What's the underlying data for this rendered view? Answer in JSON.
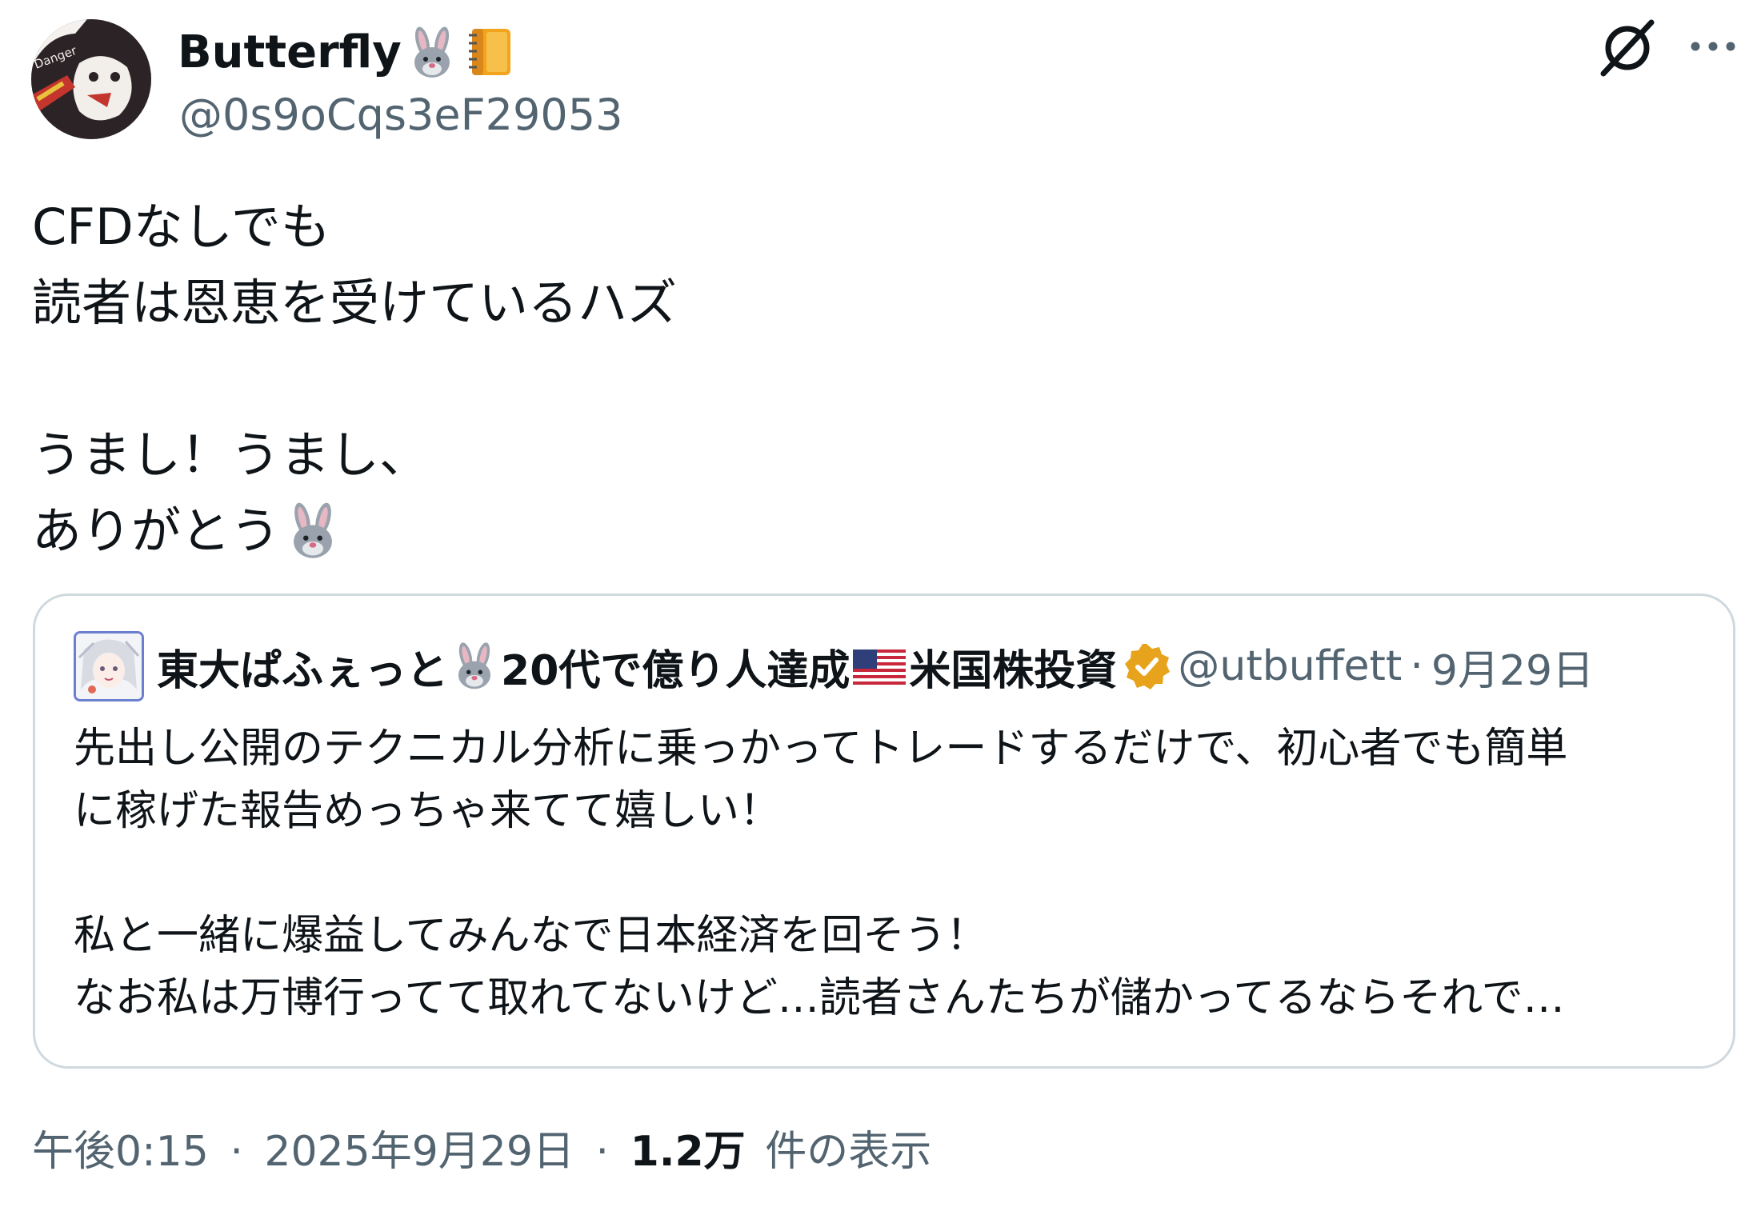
{
  "author": {
    "display_name": "Butterfly",
    "name_emojis": [
      "rabbit-emoji",
      "notebook-emoji"
    ],
    "handle": "@0s9oCqs3eF29053",
    "avatar_label": "Danger"
  },
  "tweet": {
    "lines": [
      "CFDなしでも",
      "読者は恩恵を受けているハズ",
      "",
      "うまし！うまし、",
      "ありがとう"
    ]
  },
  "quote": {
    "display_name_part1": "東大ぱふぇっと",
    "display_name_part2": "20代で億り人達成",
    "display_name_part3": "米国株投資",
    "handle": "@utbuffett",
    "separator": "·",
    "date": "9月29日",
    "lines": [
      "先出し公開のテクニカル分析に乗っかってトレードするだけで、初心者でも簡単",
      "に稼げた報告めっちゃ来てて嬉しい！",
      "",
      "私と一緒に爆益してみんなで日本経済を回そう！",
      "なお私は万博行ってて取れてないけど…読者さんたちが儲かってるならそれで…"
    ]
  },
  "meta": {
    "time": "午後0:15",
    "sep1": "·",
    "date": "2025年9月29日",
    "sep2": "·",
    "views_count": "1.2万",
    "views_label": "件の表示"
  },
  "colors": {
    "text": "#0f1419",
    "secondary": "#536471",
    "border": "#cfd9de",
    "verified_gold": "#e8a31c"
  }
}
